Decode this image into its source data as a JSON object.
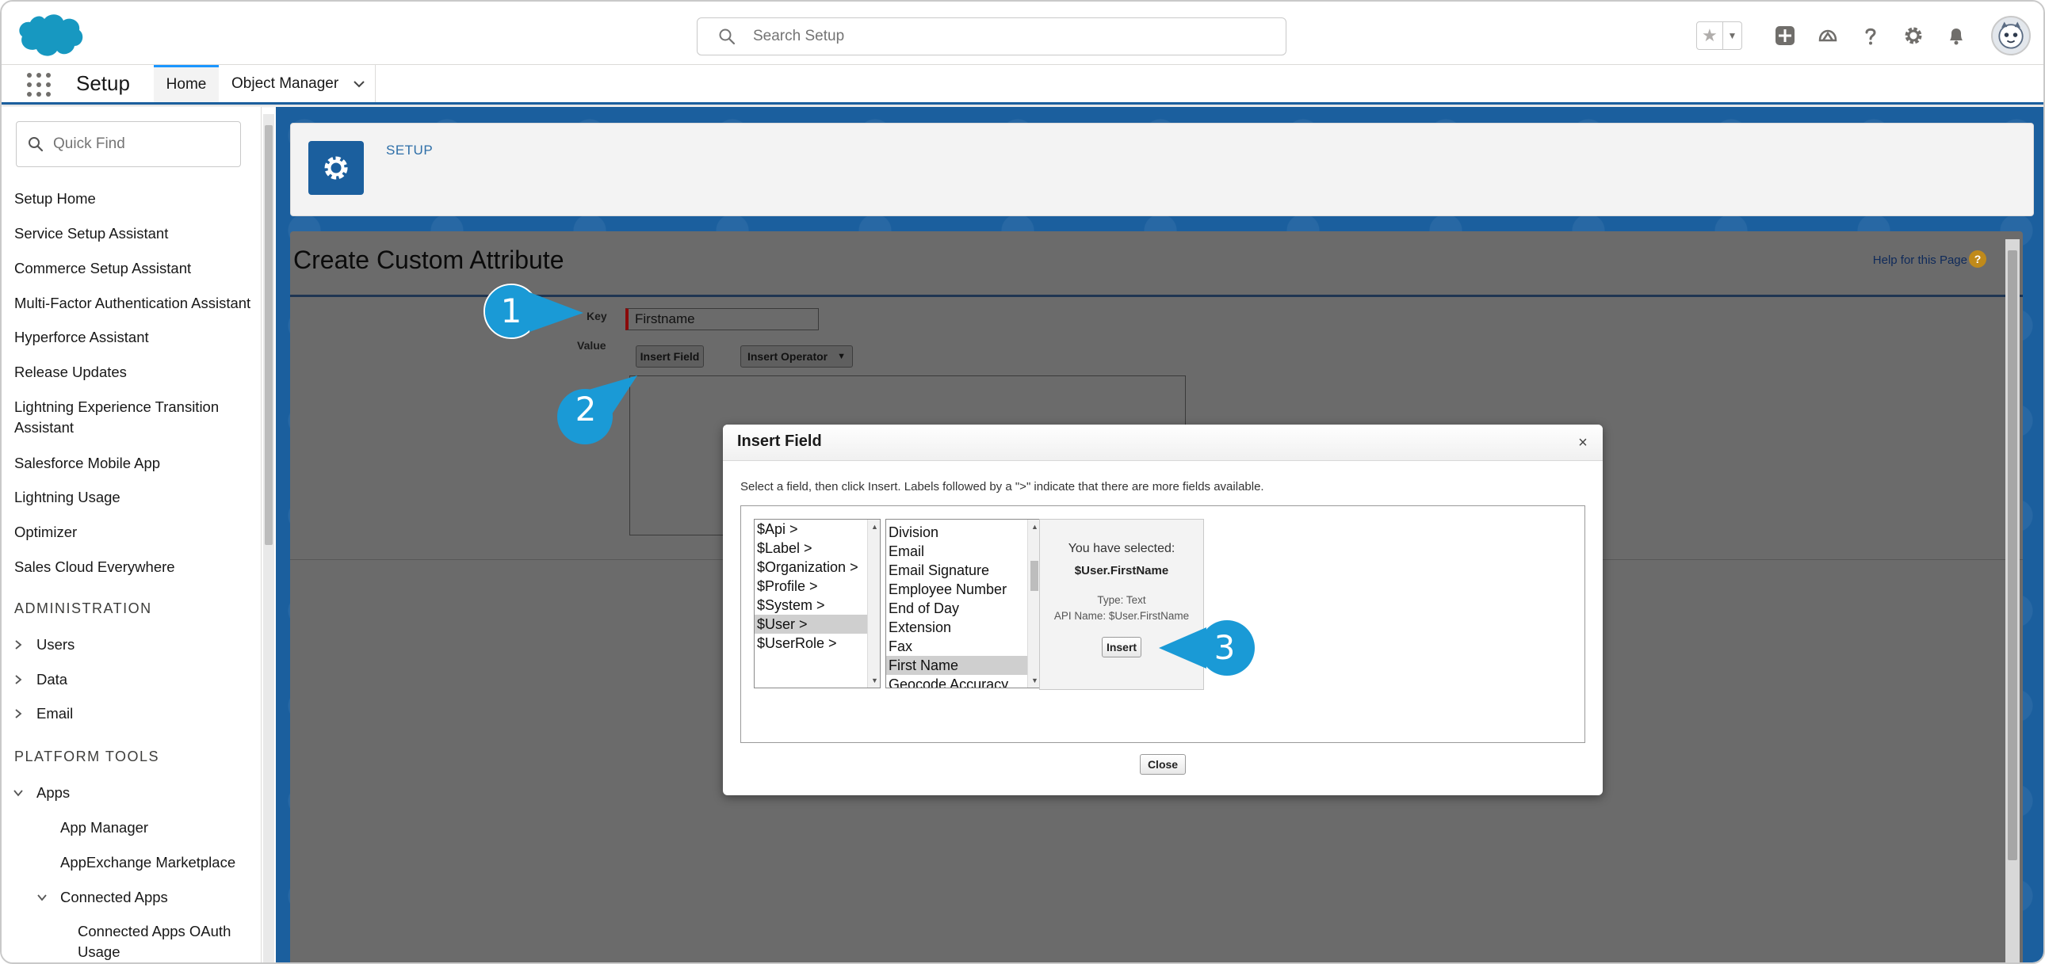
{
  "header": {
    "search_placeholder": "Search Setup",
    "icons": [
      "favorites-star-icon",
      "add-icon",
      "trailhead-icon",
      "help-icon",
      "gear-icon",
      "bell-icon",
      "avatar-icon"
    ]
  },
  "nav": {
    "app_name": "Setup",
    "tabs": [
      {
        "label": "Home",
        "active": true
      },
      {
        "label": "Object Manager",
        "active": false
      }
    ]
  },
  "sidebar": {
    "quick_find_placeholder": "Quick Find",
    "items": [
      "Setup Home",
      "Service Setup Assistant",
      "Commerce Setup Assistant",
      "Multi-Factor Authentication Assistant",
      "Hyperforce Assistant",
      "Release Updates",
      "Lightning Experience Transition Assistant",
      "Salesforce Mobile App",
      "Lightning Usage",
      "Optimizer",
      "Sales Cloud Everywhere"
    ],
    "section_admin": "ADMINISTRATION",
    "admin_items": [
      "Users",
      "Data",
      "Email"
    ],
    "section_platform": "PLATFORM TOOLS",
    "platform_items": {
      "apps": "Apps",
      "app_manager": "App Manager",
      "appexchange": "AppExchange Marketplace",
      "connected_apps": "Connected Apps",
      "connected_apps_oauth": "Connected Apps OAuth Usage"
    }
  },
  "setup_header": {
    "label": "SETUP"
  },
  "page": {
    "title": "Create Custom Attribute",
    "help_link": "Help for this Page",
    "help_icon_glyph": "?",
    "key_label": "Key",
    "key_value": "Firstname",
    "value_label": "Value",
    "insert_field_btn": "Insert Field",
    "insert_operator_btn": "Insert Operator"
  },
  "modal": {
    "title": "Insert Field",
    "close_glyph": "×",
    "instruction": "Select a field, then click Insert. Labels followed by a \">\" indicate that there are more fields available.",
    "left_options": [
      "$Api >",
      "$Label >",
      "$Organization >",
      "$Profile >",
      "$System >",
      "$User >",
      "$UserRole >"
    ],
    "left_selected": "$User >",
    "right_options": [
      "Division",
      "Email",
      "Email Signature",
      "Employee Number",
      "End of Day",
      "Extension",
      "Fax",
      "First Name",
      "Geocode Accuracy"
    ],
    "right_selected": "First Name",
    "selected_heading": "You have selected:",
    "selected_name": "$User.FirstName",
    "type_text": "Type: Text",
    "api_text": "API Name: $User.FirstName",
    "insert_btn": "Insert",
    "close_btn": "Close"
  },
  "callouts": [
    "1",
    "2",
    "3"
  ],
  "colors": {
    "brand_blue": "#1b5f9e",
    "callout_blue": "#1a9ad6",
    "salesforce_cloud": "#1798c1"
  }
}
